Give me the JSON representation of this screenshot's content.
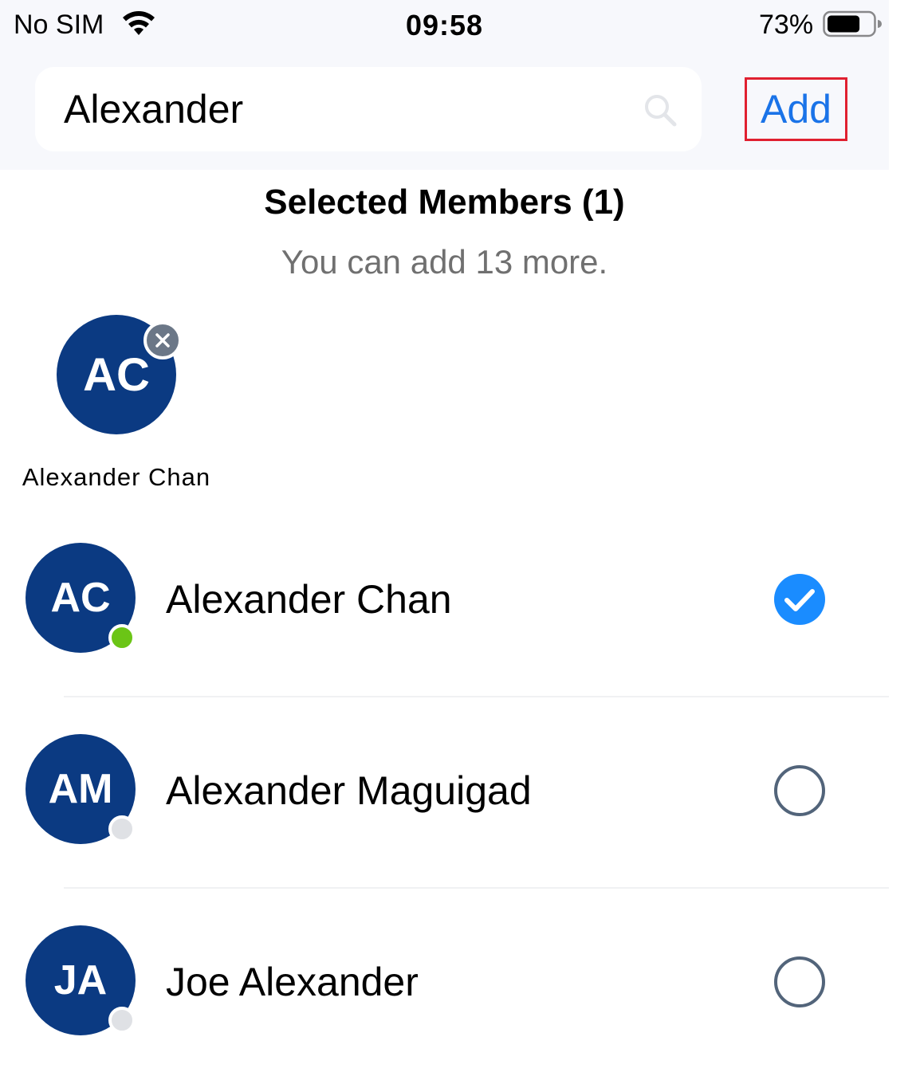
{
  "status_bar": {
    "carrier": "No SIM",
    "time": "09:58",
    "battery_percent": "73%",
    "battery_level": 0.73
  },
  "search": {
    "value": "Alexander",
    "icon": "search-icon"
  },
  "add_button": {
    "label": "Add",
    "color": "#1a73e8"
  },
  "selected": {
    "title": "Selected Members (1)",
    "subtitle": "You can add 13 more.",
    "members": [
      {
        "initials": "AC",
        "name": "Alexander Chan"
      }
    ]
  },
  "results": [
    {
      "initials": "AC",
      "name": "Alexander Chan",
      "presence": "online",
      "selected": true
    },
    {
      "initials": "AM",
      "name": "Alexander Maguigad",
      "presence": "offline",
      "selected": false
    },
    {
      "initials": "JA",
      "name": "Joe Alexander",
      "presence": "offline",
      "selected": false
    }
  ],
  "colors": {
    "avatar": "#0b3a82",
    "online": "#6bc516",
    "offline": "#dfe1e5",
    "check": "#1a8cff",
    "highlight_border": "#e02030"
  }
}
